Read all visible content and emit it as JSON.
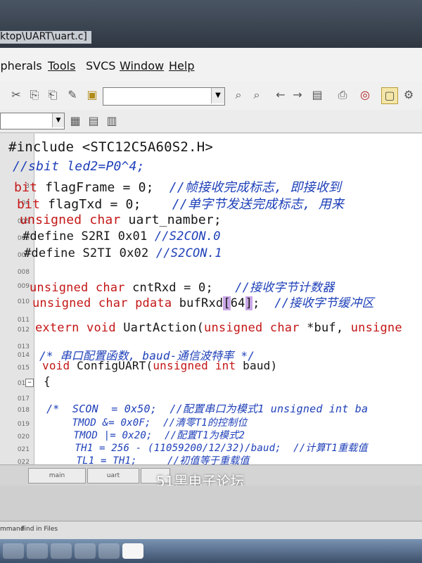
{
  "window": {
    "title": "ktop\\UART\\uart.c]"
  },
  "menu": [
    "ipherals",
    "Tools",
    "SVCS",
    "Window",
    "Help"
  ],
  "toolbar": {
    "find_value": "",
    "icons": [
      "cut-icon",
      "copy-icon",
      "paste-icon",
      "replace-icon",
      "open-folder-icon",
      "find-icon",
      "find-in-files-icon",
      "back-icon",
      "forward-icon",
      "bookmark-icon",
      "print-icon",
      "debug-icon",
      "window-icon",
      "settings-icon"
    ]
  },
  "code": {
    "lines": [
      {
        "n": "",
        "fold": "",
        "parts": [
          {
            "t": "#include <STC12C5A60S2.H>",
            "c": ""
          }
        ]
      },
      {
        "n": "",
        "fold": "",
        "parts": [
          {
            "t": "//sbit led2=P0^4;",
            "c": "cm"
          }
        ]
      },
      {
        "n": "3",
        "fold": "",
        "parts": [
          {
            "t": "bit",
            "c": "kw"
          },
          {
            "t": " flagFrame = 0;  ",
            "c": ""
          },
          {
            "t": "//帧接收完成标志, 即接收到",
            "c": "cm"
          }
        ]
      },
      {
        "n": "04",
        "fold": "",
        "parts": [
          {
            "t": "bit",
            "c": "kw"
          },
          {
            "t": " flagTxd = 0;    ",
            "c": ""
          },
          {
            "t": "//单字节发送完成标志, 用来",
            "c": "cm"
          }
        ]
      },
      {
        "n": "005",
        "fold": "",
        "parts": [
          {
            "t": "unsigned char",
            "c": "kw"
          },
          {
            "t": " uart_namber;",
            "c": ""
          }
        ]
      },
      {
        "n": "006",
        "fold": "",
        "parts": [
          {
            "t": "#define S2RI 0x01 ",
            "c": ""
          },
          {
            "t": "//S2CON.0",
            "c": "cm"
          }
        ]
      },
      {
        "n": "007",
        "fold": "",
        "parts": [
          {
            "t": "#define S2TI 0x02 ",
            "c": ""
          },
          {
            "t": "//S2CON.1",
            "c": "cm"
          }
        ]
      },
      {
        "n": "008",
        "fold": "",
        "parts": []
      },
      {
        "n": "009",
        "fold": "",
        "parts": [
          {
            "t": "unsigned char",
            "c": "kw"
          },
          {
            "t": " cntRxd = 0;   ",
            "c": ""
          },
          {
            "t": "//接收字节计数器",
            "c": "cm"
          }
        ]
      },
      {
        "n": "010",
        "fold": "",
        "parts": [
          {
            "t": "unsigned char pdata",
            "c": "kw"
          },
          {
            "t": " bufRxd",
            "c": ""
          },
          {
            "t": "[",
            "c": "br"
          },
          {
            "t": "64",
            "c": ""
          },
          {
            "t": "]",
            "c": "br"
          },
          {
            "t": ";  ",
            "c": ""
          },
          {
            "t": "//接收字节缓冲区",
            "c": "cm"
          }
        ]
      },
      {
        "n": "011",
        "fold": "",
        "parts": []
      },
      {
        "n": "012",
        "fold": "",
        "parts": [
          {
            "t": "extern void",
            "c": "kw"
          },
          {
            "t": " UartAction(",
            "c": ""
          },
          {
            "t": "unsigned char",
            "c": "kw"
          },
          {
            "t": " *buf, ",
            "c": ""
          },
          {
            "t": "unsigne",
            "c": "kw"
          }
        ]
      },
      {
        "n": "013",
        "fold": "",
        "parts": []
      },
      {
        "n": "014",
        "fold": "",
        "parts": [
          {
            "t": "/* 串口配置函数, baud-通信波特率 */",
            "c": "cm"
          }
        ]
      },
      {
        "n": "015",
        "fold": "",
        "parts": [
          {
            "t": "void",
            "c": "kw"
          },
          {
            "t": " ConfigUART(",
            "c": ""
          },
          {
            "t": "unsigned int",
            "c": "kw"
          },
          {
            "t": " baud)",
            "c": ""
          }
        ]
      },
      {
        "n": "016",
        "fold": "−",
        "parts": [
          {
            "t": "{",
            "c": ""
          }
        ]
      },
      {
        "n": "017",
        "fold": "",
        "parts": []
      },
      {
        "n": "018",
        "fold": "",
        "parts": [
          {
            "t": "/*  SCON  = 0x50;  //配置串口为模式1 unsigned int ba",
            "c": "cm"
          }
        ]
      },
      {
        "n": "019",
        "fold": "",
        "parts": [
          {
            "t": "    TMOD &= 0x0F;  //清零T1的控制位",
            "c": "cm"
          }
        ]
      },
      {
        "n": "020",
        "fold": "",
        "parts": [
          {
            "t": "    TMOD |= 0x20;  //配置T1为模式2",
            "c": "cm"
          }
        ]
      },
      {
        "n": "021",
        "fold": "",
        "parts": [
          {
            "t": "    TH1 = 256 - (11059200/12/32)/baud;  //计算T1重载值",
            "c": "cm"
          }
        ]
      },
      {
        "n": "022",
        "fold": "",
        "parts": [
          {
            "t": "    TL1 = TH1;     //初值等于重载值",
            "c": "cm"
          }
        ]
      }
    ]
  },
  "tabs": [
    "uart",
    "main",
    "uart"
  ],
  "status": {
    "left": "mmand",
    "find": "Find in Files"
  },
  "watermark": "51黑电子论坛"
}
